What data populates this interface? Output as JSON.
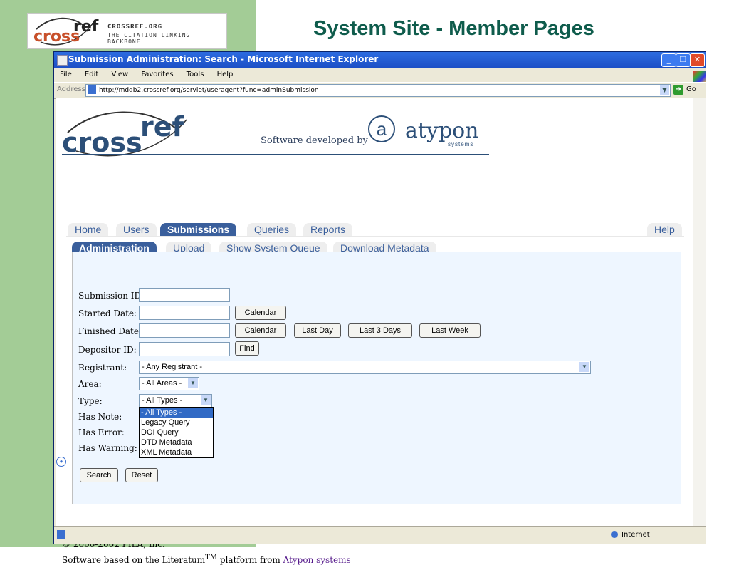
{
  "slide": {
    "title": "System Site - Member Pages",
    "logo": {
      "mark_text": "cross",
      "mark_ref": "ref",
      "line1": "CROSSREF.ORG",
      "line2": "THE CITATION LINKING BACKBONE"
    }
  },
  "window": {
    "title": "Submission Administration: Search - Microsoft Internet Explorer",
    "menu": [
      "File",
      "Edit",
      "View",
      "Favorites",
      "Tools",
      "Help"
    ],
    "address_label": "Address",
    "url": "http://mddb2.crossref.org/servlet/useragent?func=adminSubmission",
    "go_label": "Go",
    "status_zone": "Internet"
  },
  "page": {
    "brand": {
      "cross": "cross",
      "ref": "ref",
      "developed_by": "Software developed by",
      "atypon": "atypon",
      "systems": "systems"
    },
    "nav_tabs": [
      "Home",
      "Users",
      "Submissions",
      "Queries",
      "Reports"
    ],
    "nav_active": "Submissions",
    "help_label": "Help",
    "sub_tabs": [
      "Administration",
      "Upload",
      "Show System Queue",
      "Download Metadata"
    ],
    "sub_active": "Administration",
    "form": {
      "submission_id_label": "Submission ID:",
      "started_date_label": "Started Date:",
      "finished_date_label": "Finished Date:",
      "depositor_id_label": "Depositor ID:",
      "registrant_label": "Registrant:",
      "area_label": "Area:",
      "type_label": "Type:",
      "has_note_label": "Has Note:",
      "has_error_label": "Has Error:",
      "has_warning_label": "Has Warning:",
      "calendar_label": "Calendar",
      "last_day_label": "Last Day",
      "last_3_days_label": "Last 3 Days",
      "last_week_label": "Last Week",
      "find_label": "Find",
      "registrant_value": "- Any Registrant -",
      "area_value": "- All Areas -",
      "type_value": "- All Types -",
      "type_options": [
        "- All Types -",
        "Legacy Query",
        "DOI Query",
        "DTD Metadata",
        "XML Metadata"
      ],
      "search_label": "Search",
      "reset_label": "Reset"
    },
    "footer": {
      "copyright": "© 2000-2002 PILA, Inc.",
      "based_on_prefix": "Software based on the Literatum",
      "tm": "TM",
      "platform_from": " platform from ",
      "link": "Atypon systems"
    }
  }
}
